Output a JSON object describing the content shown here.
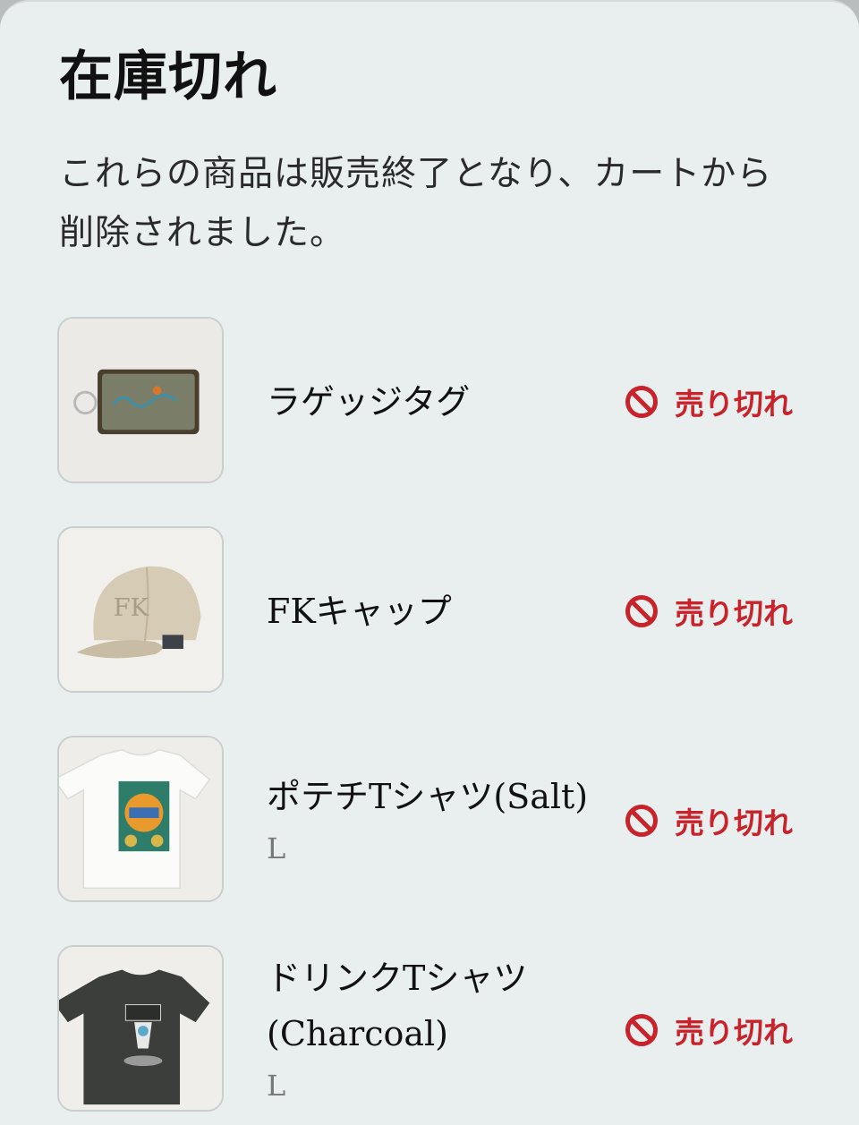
{
  "modal": {
    "title": "在庫切れ",
    "description": "これらの商品は販売終了となり、カートから削除されました。"
  },
  "items": [
    {
      "name": "ラゲッジタグ",
      "variant": "",
      "status": "売り切れ",
      "thumb_icon": "luggage-tag-image"
    },
    {
      "name": "FKキャップ",
      "variant": "",
      "status": "売り切れ",
      "thumb_icon": "cap-image"
    },
    {
      "name": "ポテチTシャツ(Salt)",
      "variant": "L",
      "status": "売り切れ",
      "thumb_icon": "white-tshirt-image"
    },
    {
      "name": "ドリンクTシャツ(Charcoal)",
      "variant": "L",
      "status": "売り切れ",
      "thumb_icon": "charcoal-tshirt-image"
    }
  ],
  "colors": {
    "sheet_background": "#e9eeee",
    "status_red": "#c8222a"
  }
}
